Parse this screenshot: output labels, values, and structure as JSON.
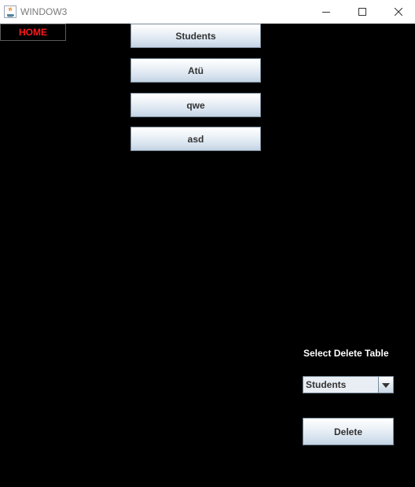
{
  "window": {
    "title": "WINDOW3",
    "icon": "java-icon"
  },
  "controls": {
    "minimize_icon": "minimize-icon",
    "maximize_icon": "maximize-icon",
    "close_icon": "close-icon"
  },
  "nav": {
    "home_label": "HOME",
    "home_color": "#ff1a1a"
  },
  "tables": [
    {
      "label": "Students"
    },
    {
      "label": "Atü"
    },
    {
      "label": "qwe"
    },
    {
      "label": "asd"
    }
  ],
  "delete_panel": {
    "label": "Select Delete Table",
    "selected_table": "Students",
    "dropdown_icon": "chevron-down-icon",
    "delete_label": "Delete"
  }
}
